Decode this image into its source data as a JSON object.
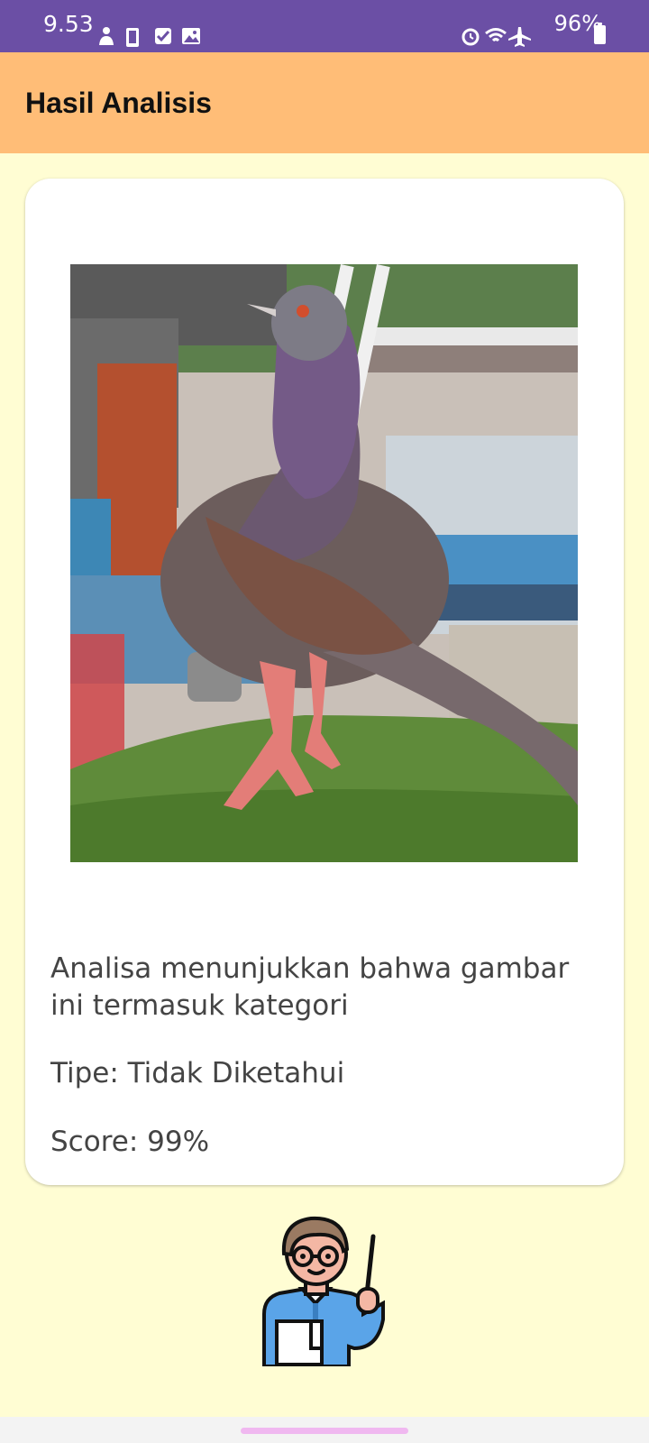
{
  "status_bar": {
    "time": "9.53",
    "battery_text": "96%",
    "left_icons": [
      "notification-icon",
      "phone-icon",
      "checkbox-icon",
      "gallery-icon"
    ],
    "right_icons": [
      "alarm-icon",
      "wifi-icon",
      "airplane-icon",
      "battery-icon"
    ]
  },
  "app_bar": {
    "title": "Hasil Analisis",
    "background": "#ffbd77"
  },
  "card": {
    "image_alt": "pigeon-photo",
    "result_text": "Analisa menunjukkan bahwa gambar ini termasuk kategori",
    "type_text": "Tipe: Tidak Diketahui",
    "score_text": "Score: 99%"
  },
  "illustration": "teacher-icon",
  "colors": {
    "status_bar": "#6b4fa5",
    "page_background": "#fffdd3",
    "card_background": "#ffffff"
  }
}
